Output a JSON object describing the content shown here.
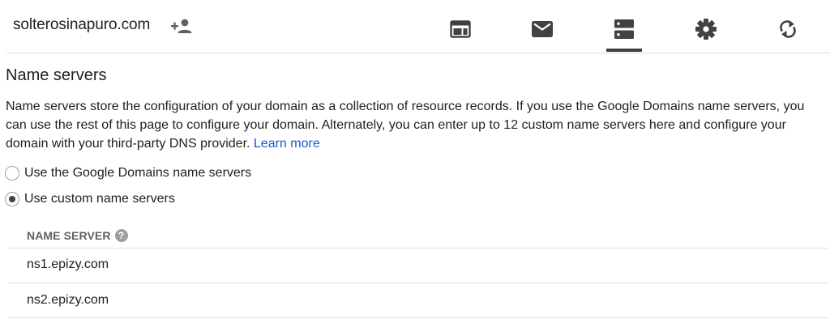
{
  "header": {
    "domain": "solterosinapuro.com",
    "add_user_icon": "person-add-icon",
    "tabs": [
      {
        "name": "website",
        "icon": "web-icon",
        "active": false
      },
      {
        "name": "email",
        "icon": "mail-icon",
        "active": false
      },
      {
        "name": "dns",
        "icon": "dns-icon",
        "active": true
      },
      {
        "name": "settings",
        "icon": "gear-icon",
        "active": false
      },
      {
        "name": "sync",
        "icon": "sync-icon",
        "active": false
      }
    ]
  },
  "section": {
    "title": "Name servers",
    "description": "Name servers store the configuration of your domain as a collection of resource records. If you use the Google Domains name servers, you can use the rest of this page to configure your domain. Alternately, you can enter up to 12 custom name servers here and configure your domain with your third-party DNS provider.",
    "learn_more": "Learn more"
  },
  "options": {
    "google": {
      "label": "Use the Google Domains name servers",
      "selected": false
    },
    "custom": {
      "label": "Use custom name servers",
      "selected": true
    }
  },
  "table": {
    "column_header": "NAME SERVER",
    "help_glyph": "?",
    "rows": [
      "ns1.epizy.com",
      "ns2.epizy.com"
    ]
  },
  "colors": {
    "link": "#1558d6",
    "active_tab": "#424242",
    "icon": "#424242"
  }
}
